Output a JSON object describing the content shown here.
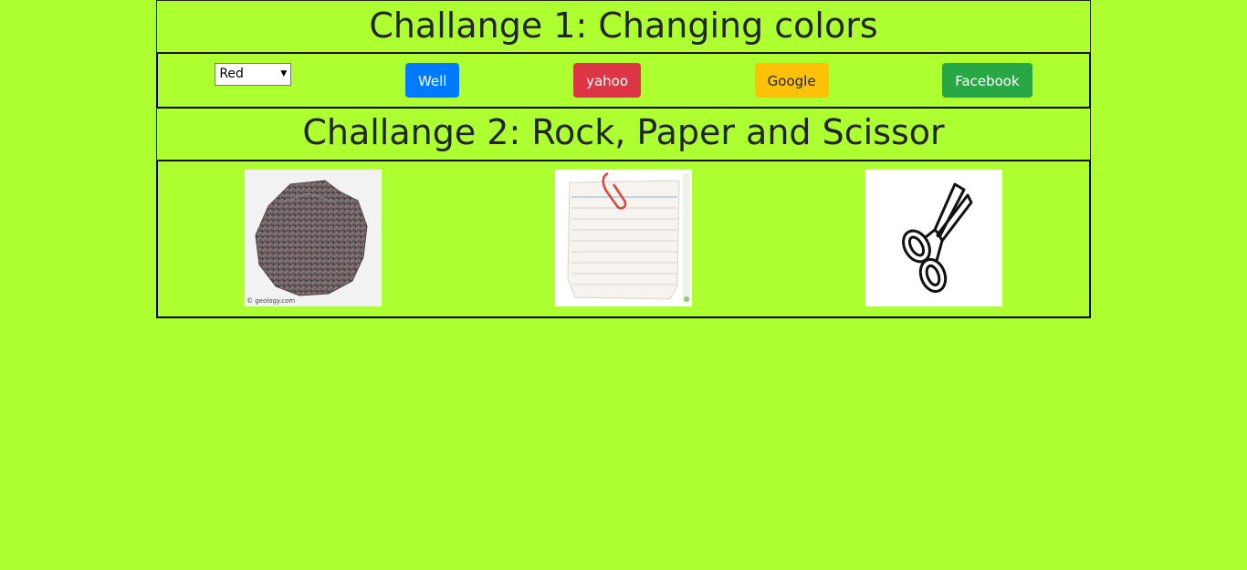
{
  "challenge1": {
    "title": "Challange 1: Changing colors",
    "select": {
      "selected": "Red"
    },
    "buttons": [
      {
        "label": "Well",
        "color": "#007bff"
      },
      {
        "label": "yahoo",
        "color": "#dc3545"
      },
      {
        "label": "Google",
        "color": "#ffc107"
      },
      {
        "label": "Facebook",
        "color": "#28a745"
      }
    ]
  },
  "challenge2": {
    "title": "Challange 2: Rock, Paper and Scissor",
    "images": [
      {
        "name": "rock",
        "caption": "© geology.com"
      },
      {
        "name": "paper"
      },
      {
        "name": "scissor"
      }
    ]
  },
  "colors": {
    "page_background": "#adff2f"
  }
}
